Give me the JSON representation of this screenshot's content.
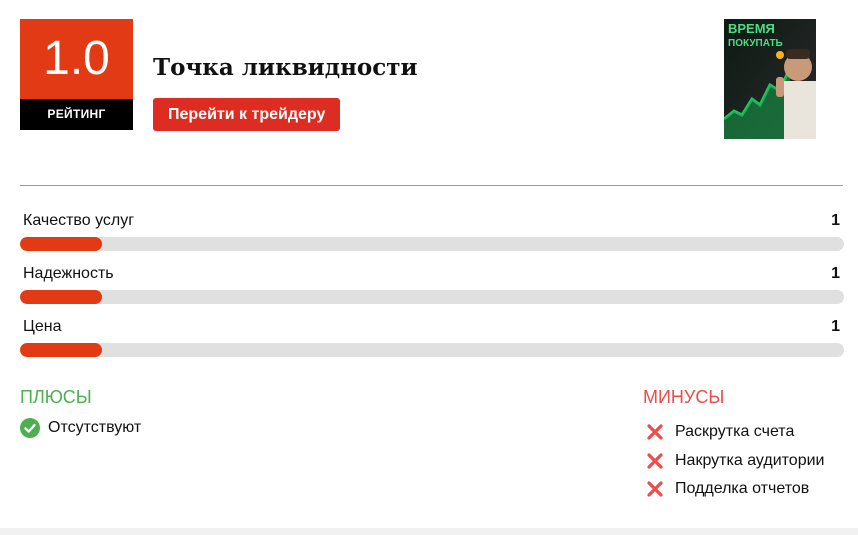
{
  "rating": {
    "score": "1.0",
    "label": "РЕЙТИНГ"
  },
  "trader": {
    "name": "Точка ликвидности",
    "button_label": "Перейти к трейдеру"
  },
  "thumbnail": {
    "line1": "ВРЕМЯ",
    "line2": "ПОКУПАТЬ"
  },
  "metrics": [
    {
      "label": "Качество услуг",
      "value": "1",
      "fill_fraction": 0.1
    },
    {
      "label": "Надежность",
      "value": "1",
      "fill_fraction": 0.1
    },
    {
      "label": "Цена",
      "value": "1",
      "fill_fraction": 0.1
    }
  ],
  "pros": {
    "title": "ПЛЮСЫ",
    "items": [
      "Отсутствуют"
    ]
  },
  "cons": {
    "title": "МИНУСЫ",
    "items": [
      "Раскрутка счета",
      "Накрутка аудитории",
      "Подделка отчетов"
    ]
  },
  "colors": {
    "accent": "#e33a16",
    "button": "#dd2c22",
    "pros": "#4caf50",
    "cons": "#ee4b4b",
    "track": "#e0e0e0"
  },
  "icons": {
    "pros": "check-circle-icon",
    "cons": "cross-icon"
  }
}
